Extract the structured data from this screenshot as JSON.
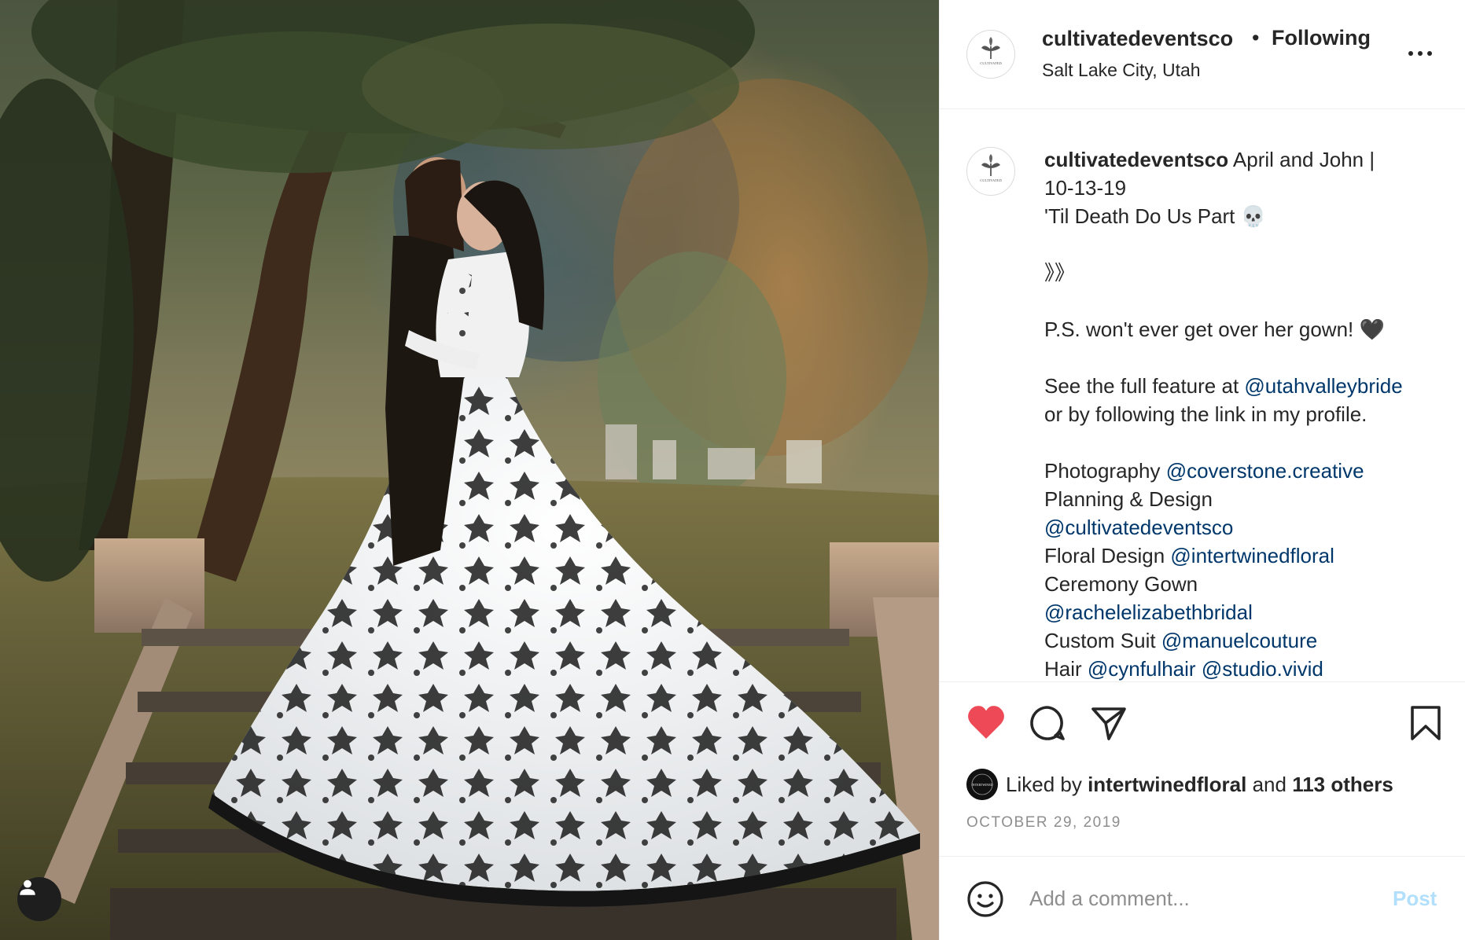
{
  "post": {
    "username": "cultivatedeventsco",
    "separator": "•",
    "follow_status": "Following",
    "location": "Salt Lake City, Utah",
    "logo_text": "CULTIVATED"
  },
  "caption": {
    "username": "cultivatedeventsco",
    "line1_text": "April and John |",
    "line2": "10-13-19",
    "line3": "'Til Death Do Us Part 💀",
    "line4": "》》",
    "line5": "P.S. won't ever get over her gown! 🖤",
    "line6_text": "See the full feature at",
    "line6_mention": "@utahvalleybride",
    "line7": "or by following the link in my profile.",
    "photo_label": "Photography",
    "photo_mention": "@coverstone.creative",
    "planning_label": "Planning & Design",
    "planning_mention": "@cultivatedeventsco",
    "floral_label": "Floral Design",
    "floral_mention": "@intertwinedfloral",
    "gown_label": "Ceremony Gown",
    "gown_mention": "@rachelelizabethbridal",
    "suit_label": "Custom Suit",
    "suit_mention": "@manuelcouture",
    "hair_label": "Hair",
    "hair_mention1": "@cynfulhair",
    "hair_mention2": "@studio.vivid"
  },
  "engagement": {
    "liked_prefix": "Liked by",
    "liked_user": "intertwinedfloral",
    "liked_joiner": "and",
    "liked_others": "113 others",
    "liked_avatar_text": "INTERTWINED",
    "date": "OCTOBER 29, 2019"
  },
  "comment_box": {
    "placeholder": "Add a comment...",
    "post_label": "Post"
  },
  "icons": {
    "like": "heart-icon",
    "comment": "comment-icon",
    "share": "share-icon",
    "save": "bookmark-icon",
    "more": "more-icon",
    "emoji": "smile-icon",
    "tagged": "user-icon"
  },
  "colors": {
    "like_red": "#ed4956",
    "link_blue": "#00376b",
    "post_disabled": "#b2dffc",
    "muted_gray": "#8e8e8e"
  }
}
